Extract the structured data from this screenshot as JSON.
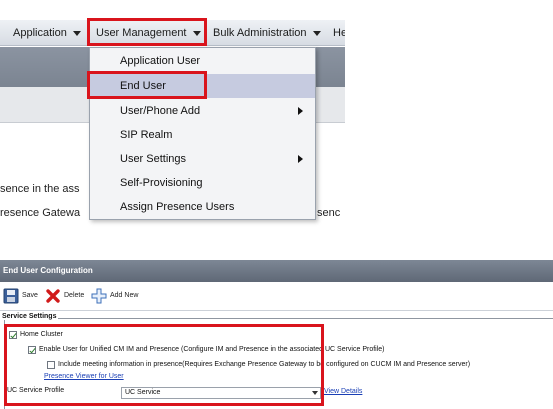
{
  "menubar": {
    "items": [
      {
        "label": "Application"
      },
      {
        "label": "User Management"
      },
      {
        "label": "Bulk Administration"
      },
      {
        "label": "He"
      }
    ]
  },
  "background_text": {
    "line1": "sence in the ass",
    "line2": "resence Gatewa",
    "line2_right": "senc"
  },
  "dropdown": {
    "items": [
      {
        "label": "Application User"
      },
      {
        "label": "End User"
      },
      {
        "label": "User/Phone Add"
      },
      {
        "label": "SIP Realm"
      },
      {
        "label": "User Settings"
      },
      {
        "label": "Self-Provisioning"
      },
      {
        "label": "Assign Presence Users"
      }
    ]
  },
  "config": {
    "title": "End User Configuration",
    "toolbar": {
      "save": "Save",
      "delete": "Delete",
      "add_new": "Add New"
    },
    "section_title": "Service Settings",
    "home_cluster": "Home Cluster",
    "enable_user": "Enable User for Unified CM IM and Presence (Configure IM and Presence in the associated UC Service Profile)",
    "include_meeting": "Include meeting information in presence(Requires Exchange Presence Gateway to be configured on CUCM IM and Presence server)",
    "presence_viewer_link": "Presence Viewer for User",
    "uc_profile_label": "UC Service Profile",
    "uc_profile_value": "UC Service",
    "view_details": "View Details"
  },
  "colors": {
    "highlight": "#d9141c",
    "link": "#1a3fb5",
    "titlebar": "#6b7482"
  }
}
